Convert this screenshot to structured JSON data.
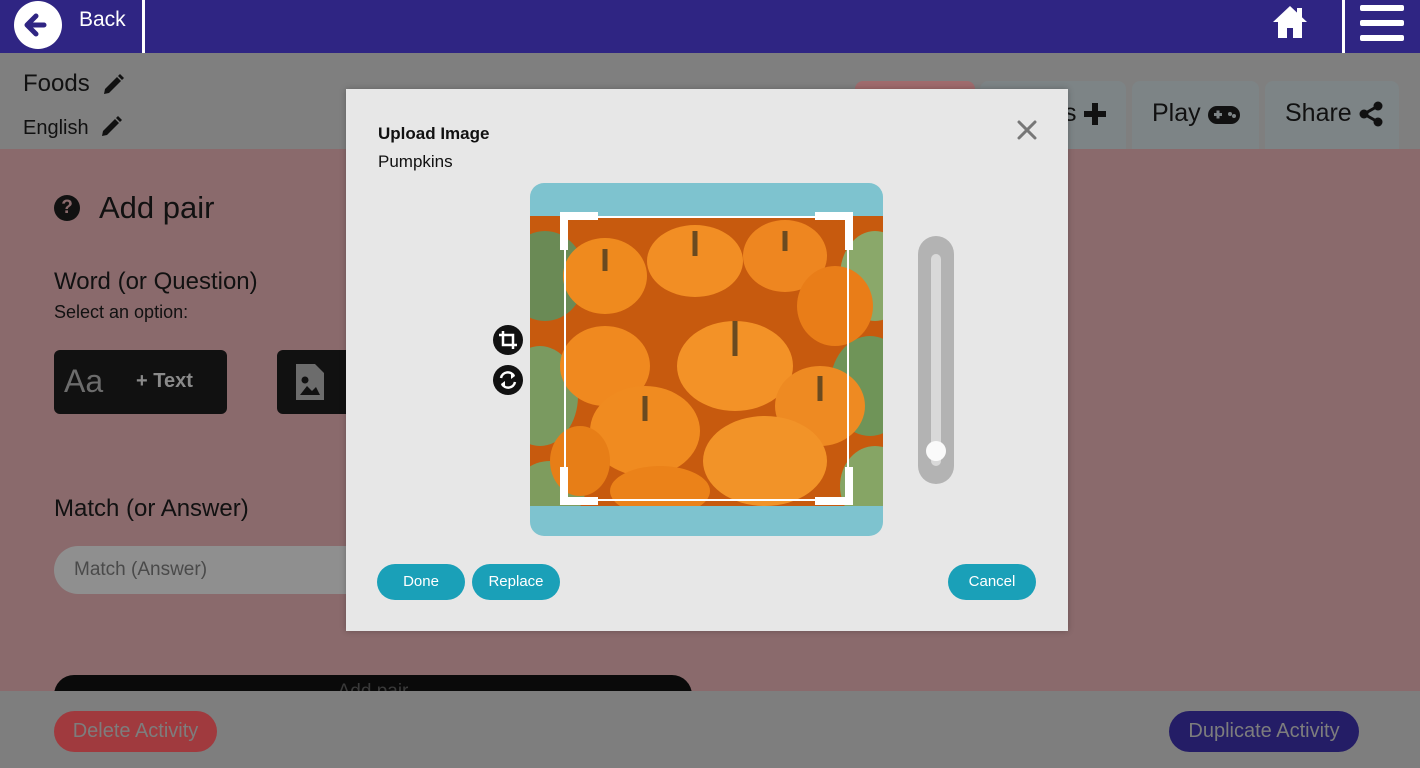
{
  "topbar": {
    "back_label": "Back"
  },
  "activity": {
    "title": "Foods",
    "language": "English"
  },
  "tabs": [
    {
      "label": ""
    },
    {
      "label": "s"
    },
    {
      "label": "Play"
    },
    {
      "label": "Share"
    }
  ],
  "editor": {
    "heading": "Add pair",
    "word_label": "Word (or Question)",
    "select_label": "Select an option:",
    "text_option_aa": "Aa",
    "text_option_label": "+ Text",
    "match_label": "Match (or Answer)",
    "match_placeholder": "Match (Answer)",
    "add_pair_label": "Add pair"
  },
  "footer": {
    "delete_label": "Delete Activity",
    "duplicate_label": "Duplicate Activity"
  },
  "modal": {
    "title": "Upload Image",
    "subtitle": "Pumpkins",
    "zoom_level": 0.1,
    "done_label": "Done",
    "replace_label": "Replace",
    "cancel_label": "Cancel"
  },
  "colors": {
    "topbar": "#2f2583",
    "accent_button": "#1aa0b8",
    "crop_background": "#7ec3cf",
    "delete": "#a03a3e",
    "duplicate": "#241d66"
  }
}
